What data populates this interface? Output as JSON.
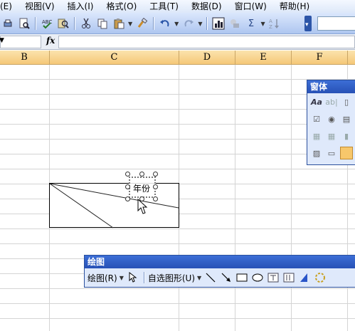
{
  "menu": {
    "items": [
      "(E)",
      "视图(V)",
      "插入(I)",
      "格式(O)",
      "工具(T)",
      "数据(D)",
      "窗口(W)",
      "帮助(H)"
    ]
  },
  "toolbar": {
    "icons": [
      "print-preview-icon",
      "spelling-icon",
      "research-icon",
      "cut-icon",
      "copy-icon",
      "paste-icon",
      "format-painter-icon",
      "undo-icon",
      "redo-icon",
      "chart-wizard-icon",
      "drawing-icon",
      "autosum-icon",
      "sort-ascending-icon"
    ],
    "autosum_glyph": "Σ"
  },
  "formula_bar": {
    "fx_label": "fx",
    "value": ""
  },
  "columns": [
    "B",
    "C",
    "D",
    "E",
    "F"
  ],
  "textbox": {
    "label": "年份"
  },
  "forms_toolbar": {
    "title": "窗体",
    "label_button": "Aa",
    "editbox_button": "ab|"
  },
  "drawing_toolbar": {
    "title": "绘图",
    "draw_menu": "绘图(R)",
    "autoshapes_menu": "自选图形(U)"
  },
  "colors": {
    "menubar": "#dde8f9",
    "toolbar": "#aec6f0",
    "column_header": "#f5c878",
    "title_bar": "#2751b6",
    "gridline": "#d4d4d4"
  }
}
